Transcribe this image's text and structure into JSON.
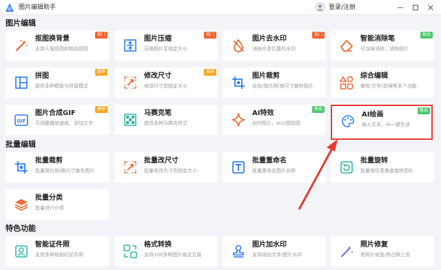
{
  "app": {
    "title": "图片编辑助手",
    "login": "登录/注册"
  },
  "window": {
    "min": "-",
    "max": "□",
    "close": "×"
  },
  "sections": {
    "edit": "图片编辑",
    "batch": "批量编辑",
    "special": "特色功能"
  },
  "cards": {
    "c1": {
      "title": "抠图换背景",
      "desc": "支持人像抠图和物品抠图",
      "badge": "热门",
      "icon": "magic-wand-icon"
    },
    "c2": {
      "title": "图片压缩",
      "desc": "压缩图片至指定大小",
      "badge": "热门",
      "icon": "compress-icon"
    },
    "c3": {
      "title": "图片去水印",
      "desc": "消除任意位置的水印",
      "badge": "热门",
      "icon": "droplet-icon"
    },
    "c4": {
      "title": "智能消除笔",
      "desc": "可涂抹消除，消除图片",
      "badge": "新品",
      "icon": "eraser-icon"
    },
    "c5": {
      "title": "拼图",
      "desc": "提供多种模板与拼接模式",
      "badge": "推荐",
      "icon": "collage-icon"
    },
    "c6": {
      "title": "修改尺寸",
      "desc": "修改尺寸到指定大小",
      "badge": "推荐",
      "icon": "resize-icon"
    },
    "c7": {
      "title": "图片裁剪",
      "desc": "自由/按比例/按尺寸裁剪图片",
      "badge": "",
      "icon": "crop-icon"
    },
    "c8": {
      "title": "综合编辑",
      "desc": "裁剪/文字/滤镜等多个功能",
      "badge": "",
      "icon": "shapes-icon"
    },
    "c9": {
      "title": "图片合成GIF",
      "desc": "可调整播放速度、添加文字",
      "badge": "推荐",
      "icon": "gif-icon"
    },
    "c10": {
      "title": "马赛克笔",
      "desc": "提供多种马赛克样式",
      "badge": "",
      "icon": "mosaic-icon"
    },
    "c11": {
      "title": "AI特效",
      "desc": "创作图片，AI以图绘图",
      "badge": "新品",
      "icon": "sparkle-icon"
    },
    "c12": {
      "title": "AI绘画",
      "desc": "输入文本，AI一键生成",
      "badge": "新品",
      "icon": "palette-icon"
    },
    "b1": {
      "title": "批量裁剪",
      "desc": "批量按比例/按尺寸裁剪图片",
      "badge": "",
      "icon": "batch-crop-icon"
    },
    "b2": {
      "title": "批量改尺寸",
      "desc": "批量修改尺寸到指定大小",
      "badge": "",
      "icon": "batch-resize-icon"
    },
    "b3": {
      "title": "批量重命名",
      "desc": "批量重命名图片名称",
      "badge": "",
      "icon": "rename-icon"
    },
    "b4": {
      "title": "批量旋转",
      "desc": "批量按任意角度旋转图片",
      "badge": "",
      "icon": "rotate-icon"
    },
    "b5": {
      "title": "批量分类",
      "desc": "批量进行分类",
      "badge": "",
      "icon": "layers-icon"
    },
    "s1": {
      "title": "智能证件照",
      "desc": "支持多种规格的证件照",
      "badge": "",
      "icon": "id-photo-icon"
    },
    "s2": {
      "title": "格式转换",
      "desc": "支持100多种图片格式互换",
      "badge": "",
      "icon": "convert-icon"
    },
    "s3": {
      "title": "图片加水印",
      "desc": "支持添加文字/图片水印",
      "badge": "",
      "icon": "stamp-icon"
    },
    "s4": {
      "title": "照片修复",
      "desc": "老照片修复/黑白照上色",
      "badge": "",
      "icon": "repair-icon"
    }
  },
  "colors": {
    "accent": "#2f7cf6",
    "hot": "#f0612b",
    "recommend": "#f5a623",
    "new": "#4cc76c",
    "highlight": "#e53935"
  }
}
